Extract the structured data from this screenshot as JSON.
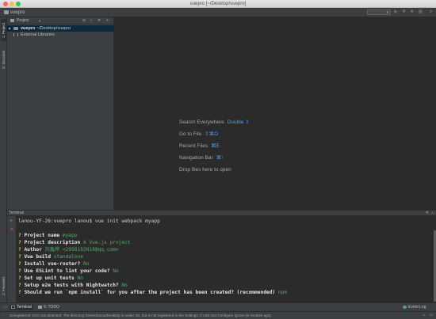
{
  "window": {
    "title": "vuepro [~/Desktop/vuepro]"
  },
  "navbar": {
    "project_label": "vuepro"
  },
  "left_strip": {
    "tab_project": "1: Project",
    "tab_structure": "Z: Structure",
    "tab_favorites": "2: Favorites"
  },
  "project_panel": {
    "header_label": "Project",
    "tree": [
      {
        "name": "vuepro",
        "path": "~/Desktop/vuepro",
        "expanded": false,
        "selected": true
      },
      {
        "name": "External Libraries",
        "path": ""
      }
    ]
  },
  "editor_hints": [
    {
      "label": "Search Everywhere",
      "shortcut": "Double ⇧"
    },
    {
      "label": "Go to File",
      "shortcut": "⇧⌘O"
    },
    {
      "label": "Recent Files",
      "shortcut": "⌘E"
    },
    {
      "label": "Navigation Bar",
      "shortcut": "⌘↑"
    },
    {
      "label": "Drop files here to open",
      "shortcut": ""
    }
  ],
  "terminal": {
    "header_label": "Terminal",
    "prompt": "lanou-YF-26:vuepro lanou$ vue init webpack myapp",
    "lines": [
      {
        "question": "Project name",
        "answer": "myapp"
      },
      {
        "question": "Project description",
        "answer": "A Vue.js project"
      },
      {
        "question": "Author",
        "answer": "刘鑫烨 <2956192818@qq.com>"
      },
      {
        "question": "Vue build",
        "answer": "standalone"
      },
      {
        "question": "Install vue-router?",
        "answer": "No"
      },
      {
        "question": "Use ESLint to lint your code?",
        "answer": "No"
      },
      {
        "question": "Set up unit tests",
        "answer": "No"
      },
      {
        "question": "Setup e2e tests with Nightwatch?",
        "answer": "No"
      },
      {
        "question": "Should we run `npm install` for you after the project has been created? (recommended)",
        "answer": "npm"
      }
    ]
  },
  "bottom_tools": {
    "terminal": "Terminal",
    "todo": "6: TODO",
    "event_log": "Event Log"
  },
  "status": {
    "message": "Unregistered VCS root detected: The directory /Users/lanou/Desktop is under Git, but is not registered in the Settings. // Add root  Configure  Ignore (8 minutes ago)"
  },
  "colors": {
    "accent": "#589df6",
    "answer_green": "#59a869",
    "question_yellow": "#e8c06a",
    "editor_bg": "#2b2b2b"
  }
}
